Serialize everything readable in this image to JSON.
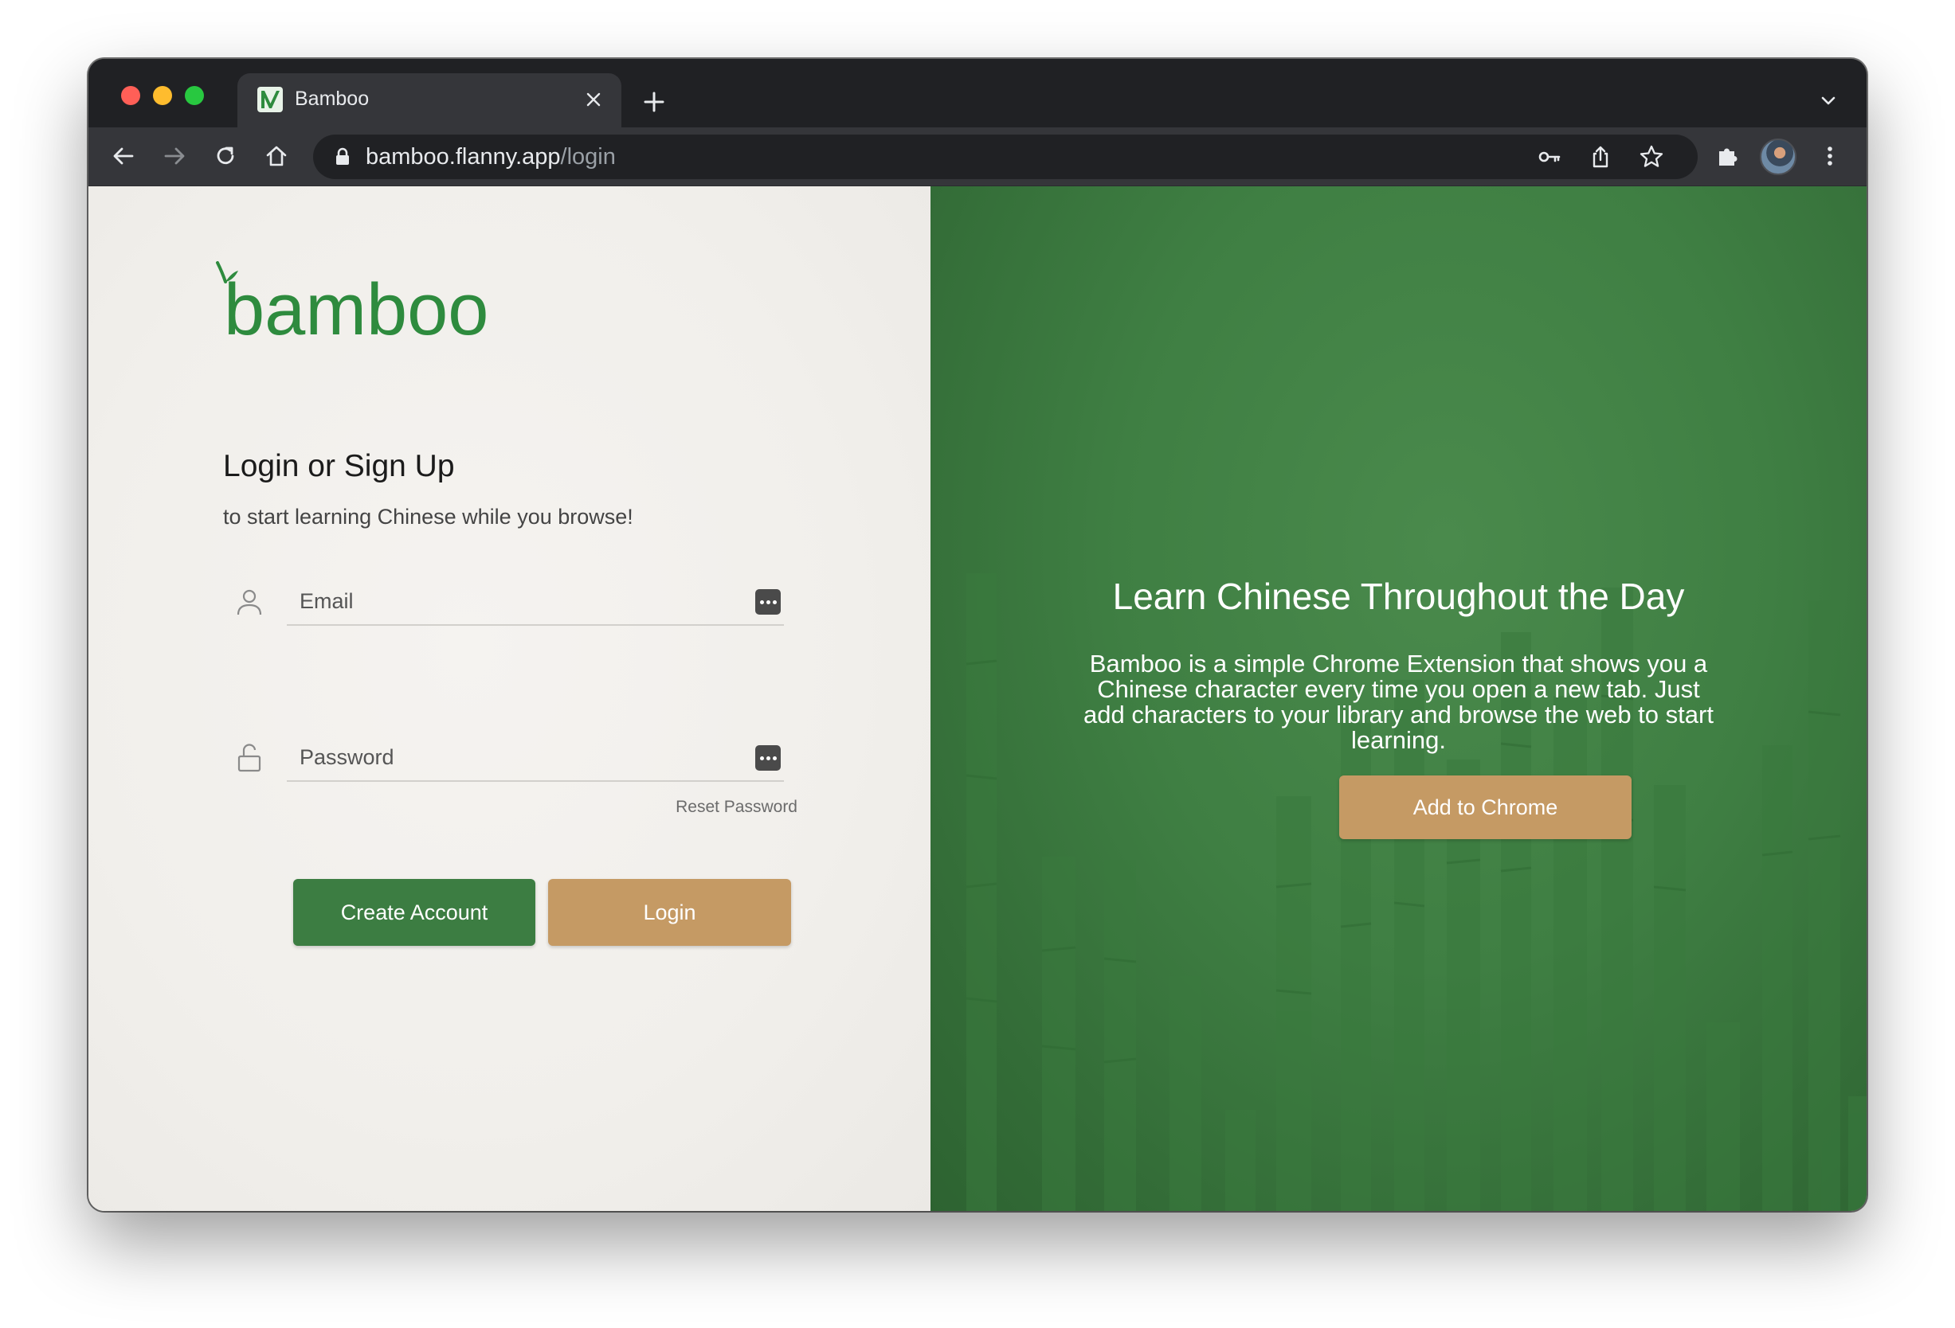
{
  "browser": {
    "tab": {
      "title": "Bamboo"
    },
    "url": {
      "host": "bamboo.flanny.app",
      "path": "/login"
    }
  },
  "page": {
    "logo_text": "bamboo",
    "login": {
      "heading": "Login or Sign Up",
      "subtitle": "to start learning Chinese while you browse!",
      "email_placeholder": "Email",
      "password_placeholder": "Password",
      "reset_link": "Reset Password",
      "create_button": "Create Account",
      "login_button": "Login"
    },
    "promo": {
      "title": "Learn Chinese Throughout the Day",
      "description": "Bamboo is a simple Chrome Extension that shows you a Chinese character every time you open a new tab. Just add characters to your library and browse the web to start learning.",
      "cta_button": "Add to Chrome"
    }
  },
  "colors": {
    "brand_green": "#2e8b3e",
    "create_button": "#3c7d42",
    "accent_tan": "#c59a64",
    "promo_bg": "#3f7f43"
  },
  "icons": {
    "tab_favicon": "bamboo-favicon-icon",
    "tab_close": "close-icon",
    "new_tab": "plus-icon",
    "tab_search": "chevron-down-icon",
    "back": "arrow-left-icon",
    "forward": "arrow-right-icon",
    "reload": "reload-icon",
    "home": "home-icon",
    "lock": "lock-icon",
    "passwords": "key-icon",
    "share": "share-icon",
    "bookmark": "star-icon",
    "extensions": "puzzle-icon",
    "menu": "kebab-menu-icon",
    "email_field": "user-icon",
    "password_field": "unlock-icon",
    "autofill": "password-manager-icon"
  }
}
